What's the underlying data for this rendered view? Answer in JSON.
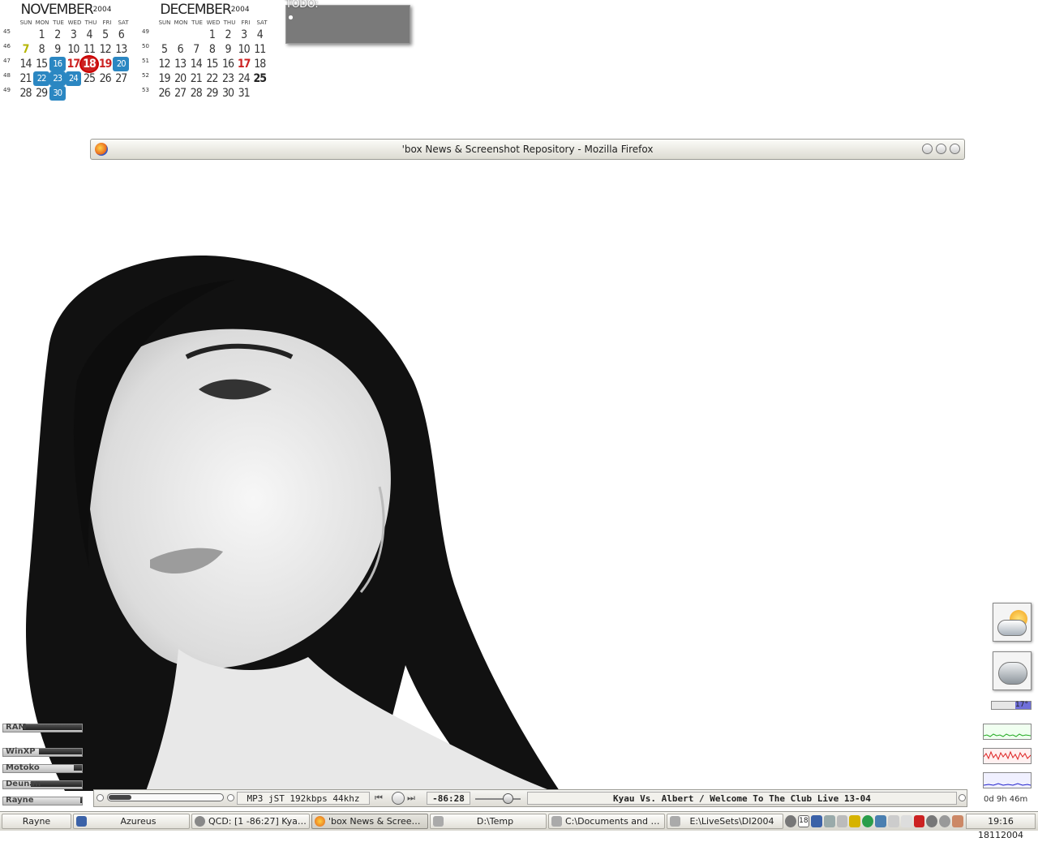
{
  "calendars": [
    {
      "month": "NOVEMBER",
      "year": "2004",
      "days_of_week": [
        "SUN",
        "MON",
        "TUE",
        "WED",
        "THU",
        "FRI",
        "SAT"
      ],
      "weeks": [
        {
          "wk": "45",
          "days": [
            "",
            "1",
            "2",
            "3",
            "4",
            "5",
            "6"
          ]
        },
        {
          "wk": "46",
          "days": [
            "7",
            "8",
            "9",
            "10",
            "11",
            "12",
            "13"
          ]
        },
        {
          "wk": "47",
          "days": [
            "14",
            "15",
            "16",
            "17",
            "18",
            "19",
            "20"
          ]
        },
        {
          "wk": "48",
          "days": [
            "21",
            "22",
            "23",
            "24",
            "25",
            "26",
            "27"
          ]
        },
        {
          "wk": "49",
          "days": [
            "28",
            "29",
            "30",
            "",
            "",
            "",
            ""
          ]
        }
      ],
      "today": "18",
      "highlight_yellow": [
        "7"
      ],
      "highlight_red": [
        "17",
        "19"
      ],
      "event_days": [
        "16",
        "20",
        "22",
        "23",
        "24",
        "30"
      ]
    },
    {
      "month": "DECEMBER",
      "year": "2004",
      "days_of_week": [
        "SUN",
        "MON",
        "TUE",
        "WED",
        "THU",
        "FRI",
        "SAT"
      ],
      "weeks": [
        {
          "wk": "49",
          "days": [
            "",
            "",
            "",
            "1",
            "2",
            "3",
            "4"
          ]
        },
        {
          "wk": "50",
          "days": [
            "5",
            "6",
            "7",
            "8",
            "9",
            "10",
            "11"
          ]
        },
        {
          "wk": "51",
          "days": [
            "12",
            "13",
            "14",
            "15",
            "16",
            "17",
            "18"
          ]
        },
        {
          "wk": "52",
          "days": [
            "19",
            "20",
            "21",
            "22",
            "23",
            "24",
            "25"
          ]
        },
        {
          "wk": "53",
          "days": [
            "26",
            "27",
            "28",
            "29",
            "30",
            "31",
            ""
          ]
        }
      ],
      "today": "",
      "highlight_yellow": [],
      "highlight_red": [
        "17"
      ],
      "event_days": [],
      "bold_days": [
        "25"
      ]
    }
  ],
  "todo": {
    "title": "TODO:",
    "items": [
      "",
      ""
    ]
  },
  "firefox_window": {
    "title": "'box News & Screenshot Repository - Mozilla Firefox"
  },
  "meters": [
    {
      "label": "RAM",
      "level": 0.75
    },
    {
      "label": "WinXP",
      "level": 0.55
    },
    {
      "label": "Motoko",
      "level": 0.1
    },
    {
      "label": "Deunan",
      "level": 0.65
    },
    {
      "label": "Rayne",
      "level": 0.02
    }
  ],
  "weather": {
    "temperature": "17°"
  },
  "uptime": "0d 9h 46m",
  "player": {
    "format": "MP3 jST 192kbps 44khz",
    "time": "-86:28",
    "track": "Kyau Vs. Albert / Welcome To The Club Live 13-04",
    "progress": 0.2,
    "volume": 0.72
  },
  "taskbar": {
    "items": [
      {
        "label": "Rayne",
        "icon": "desktop-icon"
      },
      {
        "label": "Azureus",
        "icon": "azureus-frog-icon"
      },
      {
        "label": "QCD: [1 -86:27] Kyau V...",
        "icon": "qcd-player-icon"
      },
      {
        "label": "'box News & Screens...",
        "icon": "firefox-icon",
        "active": true
      },
      {
        "label": "D:\\Temp",
        "icon": "drive-icon"
      },
      {
        "label": "C:\\Documents and Setti...",
        "icon": "drive-icon"
      },
      {
        "label": "E:\\LiveSets\\DI2004",
        "icon": "drive-icon"
      }
    ],
    "tray_badge": "18",
    "clock": "19:16 18112004"
  },
  "colors": {
    "today_ring": "#cc0000",
    "event_blue": "#2b87c2",
    "accent_red": "#cc2222"
  }
}
